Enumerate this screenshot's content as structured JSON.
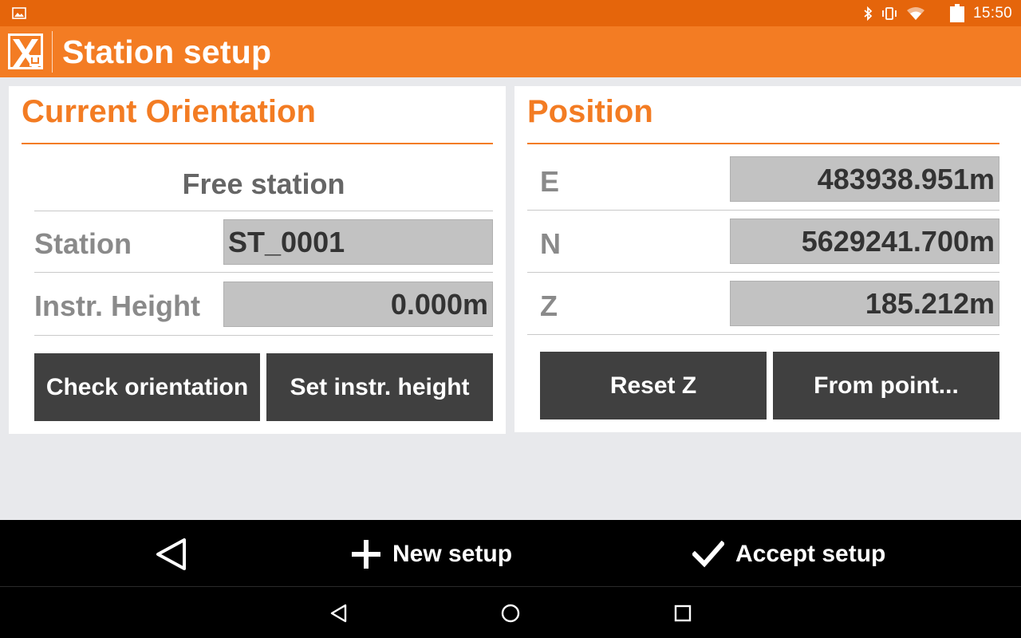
{
  "status_bar": {
    "time": "15:50",
    "icons": [
      "gallery-icon",
      "bluetooth-icon",
      "vibrate-icon",
      "wifi-icon",
      "battery-icon"
    ]
  },
  "app_bar": {
    "title": "Station setup",
    "logo": "app-logo-icon"
  },
  "orientation_panel": {
    "title": "Current Orientation",
    "mode": "Free station",
    "station_label": "Station",
    "station_value": "ST_0001",
    "height_label": "Instr. Height",
    "height_value": "0.000m",
    "check_button": "Check orientation",
    "set_height_button": "Set instr. height"
  },
  "position_panel": {
    "title": "Position",
    "rows": [
      {
        "label": "E",
        "value": "483938.951m"
      },
      {
        "label": "N",
        "value": "5629241.700m"
      },
      {
        "label": "Z",
        "value": "185.212m"
      }
    ],
    "reset_button": "Reset Z",
    "from_point_button": "From point..."
  },
  "action_bar": {
    "new_setup": "New setup",
    "accept_setup": "Accept setup",
    "icons": [
      "back-icon",
      "plus-icon",
      "checkmark-icon"
    ]
  },
  "nav_bar": {
    "icons": [
      "nav-back-icon",
      "nav-home-icon",
      "nav-recents-icon"
    ]
  },
  "colors": {
    "status_bar": "#e5650b",
    "app_bar": "#f37c23",
    "accent": "#f37c23",
    "button": "#404040",
    "field": "#c2c2c2",
    "background": "#e8e9ec"
  }
}
